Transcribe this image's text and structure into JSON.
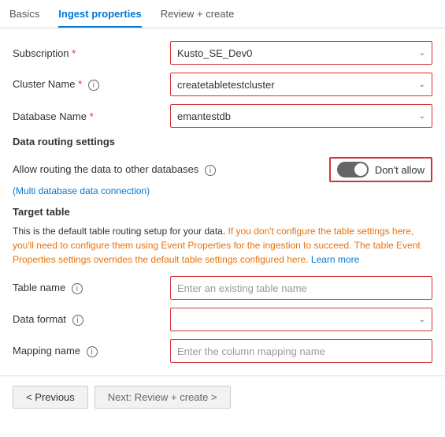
{
  "tabs": [
    {
      "label": "Basics",
      "active": false
    },
    {
      "label": "Ingest properties",
      "active": true
    },
    {
      "label": "Review + create",
      "active": false
    }
  ],
  "form": {
    "subscription": {
      "label": "Subscription",
      "required": true,
      "value": "Kusto_SE_Dev0"
    },
    "cluster_name": {
      "label": "Cluster Name",
      "required": true,
      "value": "createtabletestcluster"
    },
    "database_name": {
      "label": "Database Name",
      "required": true,
      "value": "emantestdb"
    }
  },
  "data_routing": {
    "section_label": "Data routing settings",
    "allow_label": "Allow routing the data to other databases",
    "multi_db_note": "(Multi database data connection)",
    "toggle_state": "on",
    "dont_allow": "Don't allow"
  },
  "target_table": {
    "heading": "Target table",
    "info_text_normal_1": "This is the default table routing setup for your data.",
    "info_text_orange": " If you don't configure the table settings here, you'll need to configure them using Event Properties for the ingestion to succeed. The table Event Properties settings overrides the default table settings configured here.",
    "info_text_link": " Learn more",
    "table_name_label": "Table name",
    "table_name_placeholder": "Enter an existing table name",
    "data_format_label": "Data format",
    "data_format_placeholder": "",
    "mapping_name_label": "Mapping name",
    "mapping_name_placeholder": "Enter the column mapping name"
  },
  "footer": {
    "previous_label": "< Previous",
    "next_label": "Next: Review + create >"
  }
}
